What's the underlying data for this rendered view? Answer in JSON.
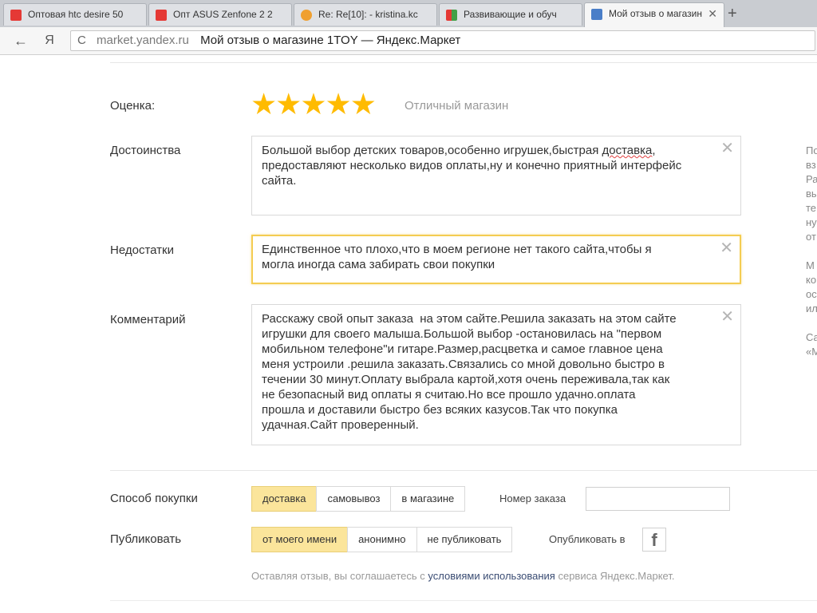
{
  "browser": {
    "tabs": [
      {
        "title": "Оптовая htc desire 50",
        "icon_color": "#e53935"
      },
      {
        "title": "Опт ASUS Zenfone 2 2",
        "icon_color": "#e53935"
      },
      {
        "title": "Re: Re[10]: - kristina.kc",
        "icon_color": "#f0a030"
      },
      {
        "title": "Развивающие и обуч",
        "icon_color": "#43a047"
      },
      {
        "title": "Мой отзыв о магазин",
        "icon_color": "#4a7ec8"
      }
    ],
    "close_glyph": "✕",
    "new_tab_glyph": "+",
    "back_glyph": "←",
    "yandex_glyph": "Я",
    "reload_glyph": "C",
    "domain": "market.yandex.ru",
    "page_title": "Мой отзыв о магазине 1TOY — Яндекс.Маркет"
  },
  "form": {
    "rating_label": "Оценка:",
    "rating_value": 5,
    "rating_max": 5,
    "rating_text": "Отличный магазин",
    "pros_label": "Достоинства",
    "pros_text": "Большой выбор детских товаров,особенно игрушек,быстрая",
    "pros_spell_word": "доставка",
    "pros_text_rest": ",\nпредоставляют несколько видов оплаты,ну и конечно приятный интерфейс\nсайта.",
    "cons_label": "Недостатки",
    "cons_text": "Единственное что плохо,что в моем регионе нет такого сайта,чтобы я\nмогла иногда сама забирать свои покупки",
    "comment_label": "Комментарий",
    "comment_text": "Расскажу свой опыт заказа  на этом сайте.Решила заказать на этом сайте\nигрушки для своего малыша.Большой выбор -остановилась на \"первом\nмобильном телефоне\"и гитаре.Размер,расцветка и самое главное цена\nменя устроили .решила заказать.Связались со мной довольно быстро в\nтечении 30 минут.Оплату выбрала картой,хотя очень переживала,так как\nне безопасный вид оплаты я считаю.Но все прошло удачно.оплата\nпрошла и доставили быстро без всяких казусов.Так что покупка\nудачная.Сайт проверенный.",
    "clear_glyph": "✕",
    "purchase_label": "Способ покупки",
    "purchase_options": [
      "доставка",
      "самовывоз",
      "в магазине"
    ],
    "purchase_selected": 0,
    "order_label": "Номер заказа",
    "order_value": "",
    "publish_label": "Публиковать",
    "publish_options": [
      "от моего имени",
      "анонимно",
      "не публиковать"
    ],
    "publish_selected": 0,
    "publish_in_label": "Опубликовать в",
    "facebook_glyph": "f",
    "terms_before": "Оставляя отзыв, вы соглашаетесь с",
    "terms_link": "условиями использования",
    "terms_after": "сервиса Яндекс.Маркет."
  },
  "right_cut_lines": [
    "По",
    "вз",
    "Ра",
    "вы",
    "те",
    "ну",
    "от",
    "",
    "М",
    "ко",
    "ос",
    "ил",
    "",
    "Са",
    "«М"
  ]
}
